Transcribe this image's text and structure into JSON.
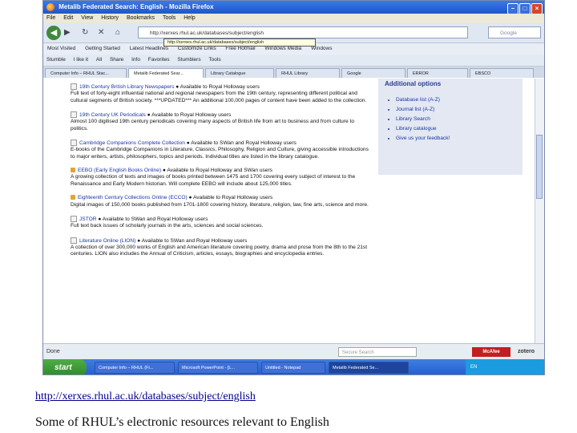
{
  "window": {
    "title": "Metalib Federated Search: English - Mozilla Firefox",
    "menu": [
      "File",
      "Edit",
      "View",
      "History",
      "Bookmarks",
      "Tools",
      "Help"
    ]
  },
  "navbar": {
    "url": "http://xerxes.rhul.ac.uk/databases/subject/english",
    "url_tooltip": "http://xerxes.rhul.ac.uk/databases/subject/english",
    "search_placeholder": "Google"
  },
  "bookmarks": [
    "Most Visited",
    "Getting Started",
    "Latest Headlines",
    "Customize Links",
    "Free Hotmail",
    "Windows Media",
    "Windows"
  ],
  "toolbar2": [
    "Stumble",
    "I like it",
    "All",
    "Share",
    "Info",
    "Favorites",
    "Stumblers",
    "Tools"
  ],
  "tabs": [
    {
      "label": "Computer Info – RHUL Stac..."
    },
    {
      "label": "Metalib Federated Sear...",
      "active": true
    },
    {
      "label": "Library Catalogue"
    },
    {
      "label": "RHUL Library"
    },
    {
      "label": "Google"
    },
    {
      "label": "ERROR"
    },
    {
      "label": "EBSCO"
    }
  ],
  "entries": [
    {
      "title": "19th Century British Library Newspapers",
      "access": "Available to Royal Holloway users",
      "desc": "Full text of forty-eight influential national and regional newspapers from the 19th century, representing different political and cultural segments of British society. ***UPDATED*** An additional 100,000 pages of content have been added to the collection."
    },
    {
      "title": "19th Century UK Periodicals",
      "access": "Available to Royal Holloway users",
      "desc": "Almost 100 digitised 19th century periodicals covering many aspects of British life from art to business and from culture to politics."
    },
    {
      "title": "Cambridge Companions Complete Collection",
      "access": "Available to SWan and Royal Holloway users",
      "desc": "E-books of the Cambridge Companions in Literature, Classics, Philosophy, Religion and Culture, giving accessible introductions to major writers, artists, philosophers, topics and periods. Individual titles are listed in the library catalogue."
    },
    {
      "title": "EEBO (Early English Books Online)",
      "access": "Available to Royal Holloway and SWan users",
      "desc": "A growing collection of texts and images of books printed between 1475 and 1700 covering every subject of interest to the Renaissance and Early Modern historian. Will complete EEBO will include about 125,000 titles."
    },
    {
      "title": "Eighteenth Century Collections Online (ECCO)",
      "access": "Available to Royal Holloway users",
      "desc": "Digital images of 150,000 books published from 1701-1800 covering history, literature, religion, law, fine arts, science and more."
    },
    {
      "title": "JSTOR",
      "access": "Available to SWan and Royal Holloway users",
      "desc": "Full text back issues of scholarly journals in the arts, sciences and social sciences."
    },
    {
      "title": "Literature Online (LION)",
      "access": "Available to SWan and Royal Holloway users",
      "desc": "A collection of over 300,000 works of English and American literature covering poetry, drama and prose from the 8th to the 21st centuries. LION also includes the Annual of Criticism, articles, essays, biographies and encyclopedia entries."
    }
  ],
  "sidebar": {
    "heading": "Additional options",
    "items": [
      "Database list (A-Z)",
      "Journal list (A-Z)",
      "Library Search",
      "Library catalogue",
      "Give us your feedback!"
    ]
  },
  "statusbar": {
    "left": "Done",
    "search_placeholder": "Secure Search",
    "mcafee": "McAfee",
    "zotero": "zotero"
  },
  "taskbar": {
    "start": "start",
    "buttons": [
      "Computer Info – RHUL (Fi...",
      "Microsoft PowerPoint - [L...",
      "Untitled - Notepad",
      "Metalib Federated Se..."
    ],
    "tray": "EN"
  },
  "caption": {
    "link": "http://xerxes.rhul.ac.uk/databases/subject/english",
    "text": "Some of RHUL’s electronic resources relevant to English"
  }
}
